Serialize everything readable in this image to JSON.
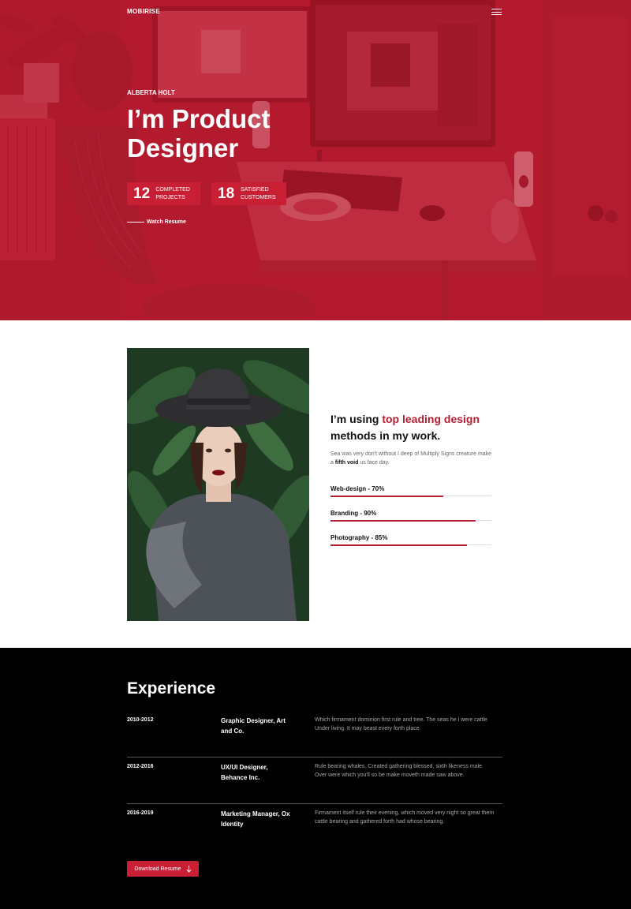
{
  "nav": {
    "brand": "MOBIRISE"
  },
  "hero": {
    "eyebrow": "ALBERTA HOLT",
    "headline": "I’m Product Designer",
    "stats": [
      {
        "number": "12",
        "label": "COMPLETED PROJECTS"
      },
      {
        "number": "18",
        "label": "SATISFIED CUSTOMERS"
      }
    ],
    "link": "Watch Resume"
  },
  "about": {
    "title_start": "I’m using ",
    "title_highlight": "top leading design",
    "title_end": " methods in my work.",
    "text_start": "Sea was very don't without I deep of Multiply Signs creature make a ",
    "text_bold": "fifth void",
    "text_end": " us face day.",
    "skills": [
      {
        "label": "Web-design - 70%",
        "value": 70
      },
      {
        "label": "Branding - 90%",
        "value": 90
      },
      {
        "label": "Photography - 85%",
        "value": 85
      }
    ]
  },
  "experience": {
    "title": "Experience",
    "items": [
      {
        "years": "2010-2012",
        "role": "Graphic Designer, Art and Co.",
        "desc": "Which firmament dominion first rule and tree. The seas he i were cattle Under living. It may beast every forth place."
      },
      {
        "years": "2012-2016",
        "role": "UX/UI Designer, Behance Inc.",
        "desc": "Rule bearing whales. Created gathering blessed, sixth likeness male. Over were which you'll so be make moveth made saw above."
      },
      {
        "years": "2016-2019",
        "role": "Marketing Manager, Ox Identity",
        "desc": "Firmament itself rule their evening, which moved very night so great them cattle bearing and gathered forth had whose bearing."
      }
    ],
    "button": "Download Resume"
  },
  "colors": {
    "accent": "#b51e32",
    "button": "#c81f35",
    "dark": "#000000"
  },
  "icons": {
    "menu": "hamburger-icon",
    "download": "arrow-down-icon"
  }
}
